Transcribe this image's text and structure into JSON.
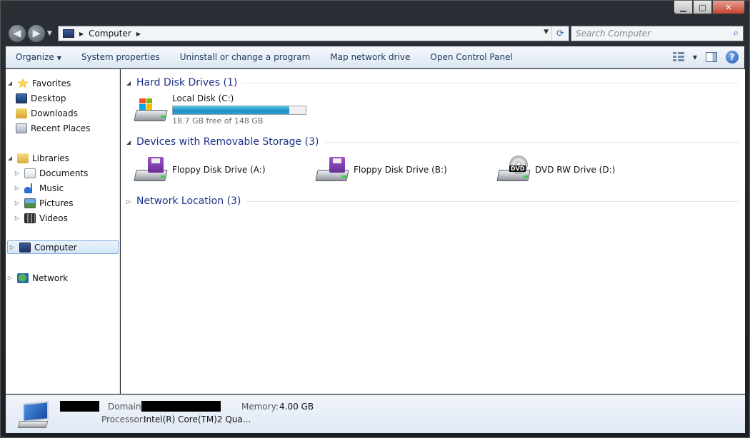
{
  "window": {
    "caption_buttons": {
      "minimize": "▁",
      "maximize": "□",
      "close": "✕"
    }
  },
  "address_bar": {
    "back_icon": "◀",
    "forward_icon": "▶",
    "crumb": "Computer",
    "separator": "▶",
    "refresh_icon": "⟳"
  },
  "search": {
    "placeholder": "Search Computer",
    "icon": "⌕"
  },
  "toolbar": {
    "organize": "Organize",
    "system_properties": "System properties",
    "uninstall": "Uninstall or change a program",
    "map_network_drive": "Map network drive",
    "open_control_panel": "Open Control Panel",
    "help": "?"
  },
  "nav_pane": {
    "favorites": "Favorites",
    "desktop": "Desktop",
    "downloads": "Downloads",
    "recent_places": "Recent Places",
    "libraries": "Libraries",
    "documents": "Documents",
    "music": "Music",
    "pictures": "Pictures",
    "videos": "Videos",
    "computer": "Computer",
    "network": "Network"
  },
  "groups": {
    "hard_disk": {
      "label": "Hard Disk Drives (1)",
      "drives": [
        {
          "name": "Local Disk (C:)",
          "free_text": "18.7 GB free of 148 GB",
          "used_fraction": 0.874
        }
      ]
    },
    "removable": {
      "label": "Devices with Removable Storage (3)",
      "drives": [
        {
          "name": "Floppy Disk Drive (A:)"
        },
        {
          "name": "Floppy Disk Drive (B:)"
        },
        {
          "name": "DVD RW Drive (D:)",
          "badge": "DVD"
        }
      ]
    },
    "network": {
      "label": "Network Location (3)"
    }
  },
  "details": {
    "domain_label": "Domain:",
    "memory_label": "Memory:",
    "memory_value": "4.00 GB",
    "processor_label": "Processor:",
    "processor_value": "Intel(R) Core(TM)2 Qua..."
  }
}
